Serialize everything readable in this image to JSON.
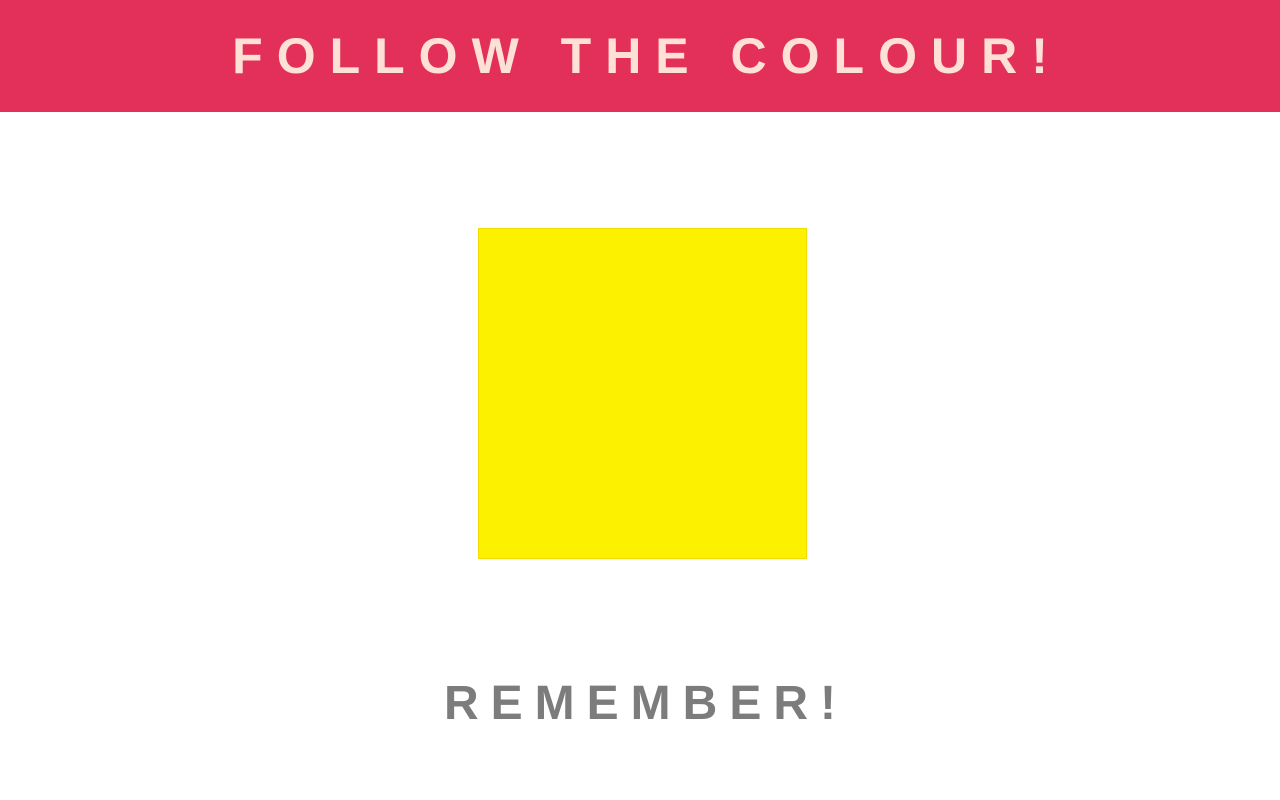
{
  "header": {
    "title": "FOLLOW THE COLOUR!"
  },
  "game": {
    "current_color": "#fcf200",
    "current_color_name": "yellow"
  },
  "footer": {
    "message": "REMEMBER!"
  },
  "colors": {
    "header_bg": "#e3305b",
    "title_text": "#fde0d6",
    "message_text": "#7c7c7c"
  }
}
